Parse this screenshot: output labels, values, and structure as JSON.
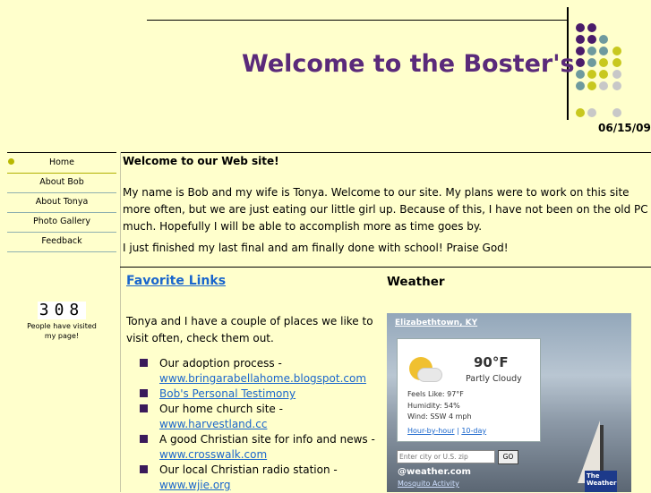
{
  "header": {
    "title": "Welcome to the Boster's",
    "date": "06/15/09"
  },
  "colors": {
    "purple": "#4a1c6a",
    "teal": "#6e9a9e",
    "yellow": "#c8c81e",
    "gray": "#c8c8c8",
    "background": "#ffffcc"
  },
  "nav": {
    "items": [
      {
        "label": "Home"
      },
      {
        "label": "About Bob"
      },
      {
        "label": "About Tonya"
      },
      {
        "label": "Photo Gallery"
      },
      {
        "label": "Feedback"
      }
    ]
  },
  "counter": {
    "value": "308",
    "text": "People have visited my page!"
  },
  "welcome": {
    "heading": "Welcome to our Web site!",
    "intro": "My name is Bob and my wife is Tonya.  Welcome to our site.  My plans were to work on this site more often, but we are just eating our little girl up.  Because of this, I have not been on the old PC much.  Hopefully I will be able to accomplish more as time goes by.",
    "finished": "I just finished my last final and am finally done with school!  Praise God!"
  },
  "favorites": {
    "heading": "Favorite Links",
    "intro": "Tonya and I have a couple of places we like to visit often, check them out.",
    "items": [
      {
        "text": " Our adoption process - ",
        "link": "www.bringarabellahome.blogspot.com"
      },
      {
        "text": "",
        "link": "Bob's Personal Testimony"
      },
      {
        "text": "Our home church site - ",
        "link": "www.harvestland.cc"
      },
      {
        "text": "A good Christian site for info and news - ",
        "link": "www.crosswalk.com"
      },
      {
        "text": "Our local Christian radio station - ",
        "link": "www.wjie.org"
      }
    ]
  },
  "weather": {
    "heading": "Weather",
    "location": "Elizabethtown, KY",
    "temperature": "90°F",
    "condition": "Partly Cloudy",
    "feels_like": "Feels Like: 97°F",
    "humidity": "Humidity: 54%",
    "wind": "Wind: SSW 4 mph",
    "link_hourly": "Hour-by-hour",
    "link_separator": "|",
    "link_10day": "10-day",
    "input_placeholder": "Enter city or U.S. zip",
    "go_label": "GO",
    "brand": "@weather.com",
    "mosquito_link": "Mosquito Activity",
    "logo_text": "The Weather"
  }
}
